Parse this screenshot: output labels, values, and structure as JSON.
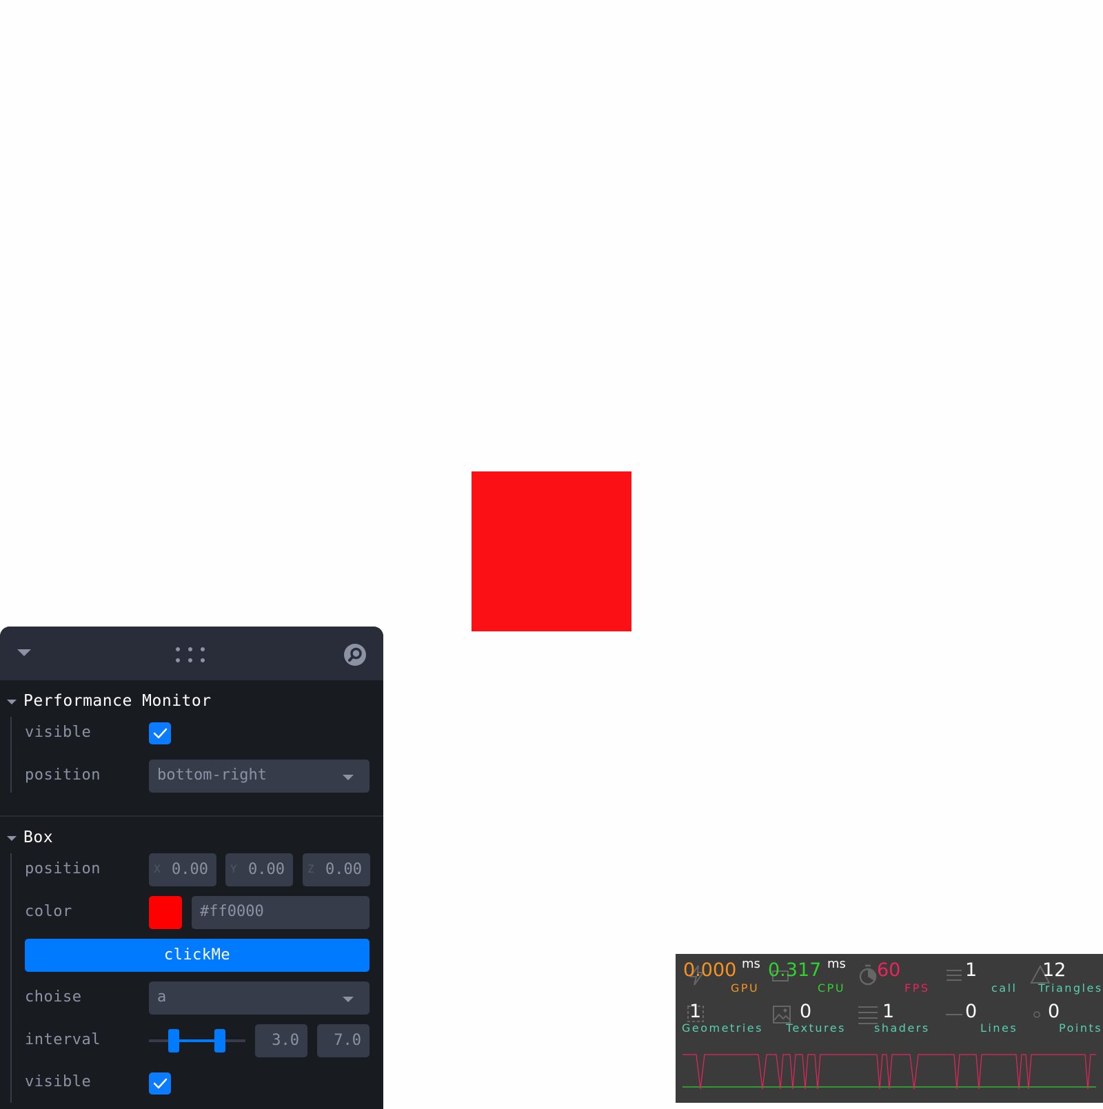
{
  "scene": {
    "box_color": "#fa1015"
  },
  "panel": {
    "perf_folder": {
      "title": "Performance Monitor",
      "visible_label": "visible",
      "visible_checked": true,
      "position_label": "position",
      "position_value": "bottom-right"
    },
    "box_folder": {
      "title": "Box",
      "position_label": "position",
      "position": {
        "x_axis": "X",
        "x": "0.00",
        "y_axis": "Y",
        "y": "0.00",
        "z_axis": "Z",
        "z": "0.00"
      },
      "color_label": "color",
      "color_value": "#ff0000",
      "button_label": "clickMe",
      "choise_label": "choise",
      "choise_value": "a",
      "interval_label": "interval",
      "interval_min": "3.0",
      "interval_max": "7.0",
      "visible_label": "visible",
      "visible_checked": true
    },
    "accent": "#007bff"
  },
  "perf_monitor": {
    "gpu": {
      "value": "0.000",
      "unit": "ms",
      "label": "GPU",
      "color": "#f79420"
    },
    "cpu": {
      "value": "0.317",
      "unit": "ms",
      "label": "CPU",
      "color": "#2fd22f"
    },
    "fps": {
      "value": "60",
      "label": "FPS",
      "color": "#e8255e"
    },
    "calls": {
      "value": "1",
      "label": "call"
    },
    "triangles": {
      "value": "12",
      "label": "Triangles"
    },
    "geometries": {
      "value": "1",
      "label": "Geometries"
    },
    "textures": {
      "value": "0",
      "label": "Textures"
    },
    "shaders": {
      "value": "1",
      "label": "shaders"
    },
    "lines": {
      "value": "0",
      "label": "Lines"
    },
    "points": {
      "value": "0",
      "label": "Points"
    },
    "label_color": "#56d0b0"
  }
}
